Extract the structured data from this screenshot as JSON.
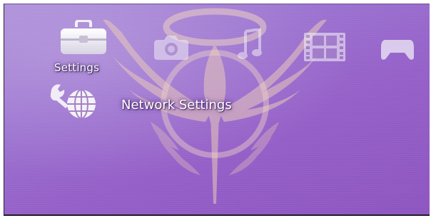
{
  "xmb": {
    "categories": [
      {
        "id": "settings",
        "label": "Settings",
        "icon": "toolbox-icon",
        "selected": true
      },
      {
        "id": "photo",
        "icon": "camera-icon"
      },
      {
        "id": "music",
        "icon": "music-note-icon"
      },
      {
        "id": "video",
        "icon": "film-strip-icon"
      },
      {
        "id": "game",
        "icon": "gamepad-icon"
      }
    ],
    "selected_item": {
      "label": "Network Settings",
      "icon": "network-globe-icon"
    }
  },
  "wallpaper": {
    "theme": "winged emblem",
    "colors": {
      "background": "#9a70cf",
      "emblem": "#e8c7b8"
    }
  }
}
